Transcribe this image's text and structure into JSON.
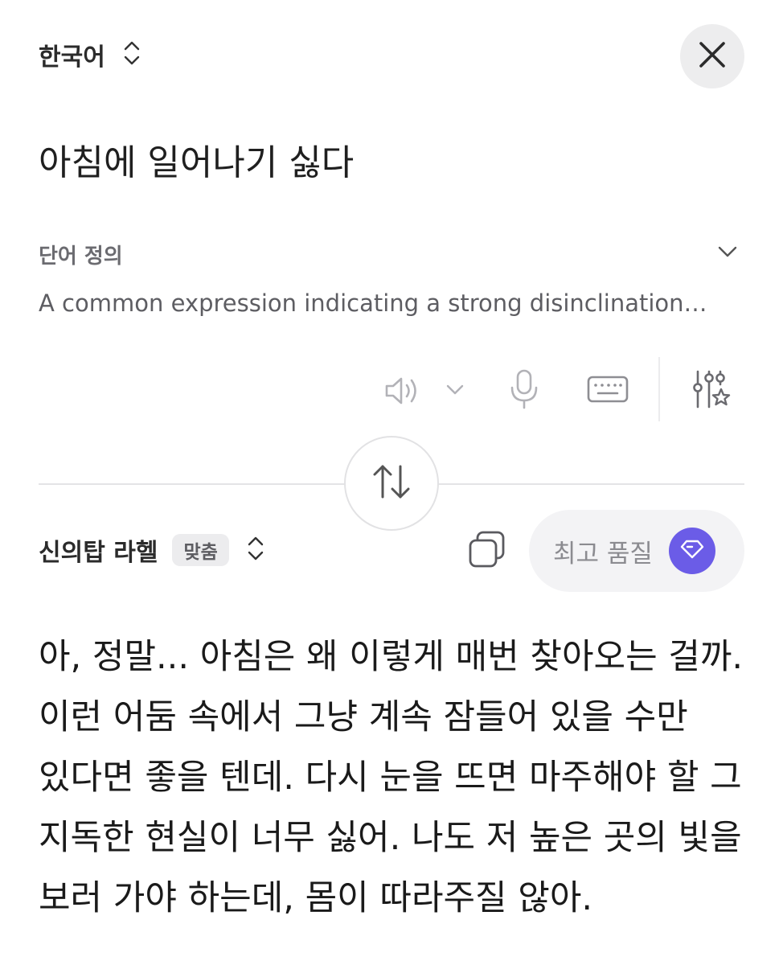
{
  "source": {
    "language": "한국어",
    "text": "아침에 일어나기 싫다"
  },
  "definition": {
    "title": "단어 정의",
    "text": "A common expression indicating a strong disinclination…"
  },
  "toolbar": {
    "icons": [
      "speaker-icon",
      "chevron-down-icon",
      "microphone-icon",
      "keyboard-icon",
      "tone-settings-icon"
    ]
  },
  "target": {
    "language": "신의탑 라헬",
    "badge": "맞춤",
    "quality_label": "최고 품질",
    "text": "아, 정말... 아침은 왜 이렇게 매번 찾아오는 걸까. 이런 어둠 속에서 그냥 계속 잠들어 있을 수만 있다면 좋을 텐데. 다시 눈을 뜨면 마주해야 할 그 지독한 현실이 너무 싫어. 나도 저 높은 곳의 빛을 보러 가야 하는데, 몸이 따라주질 않아."
  },
  "colors": {
    "accent": "#6b5ce7",
    "icon_gray": "#a9a9ae",
    "text_dark": "#1a1a1a"
  }
}
